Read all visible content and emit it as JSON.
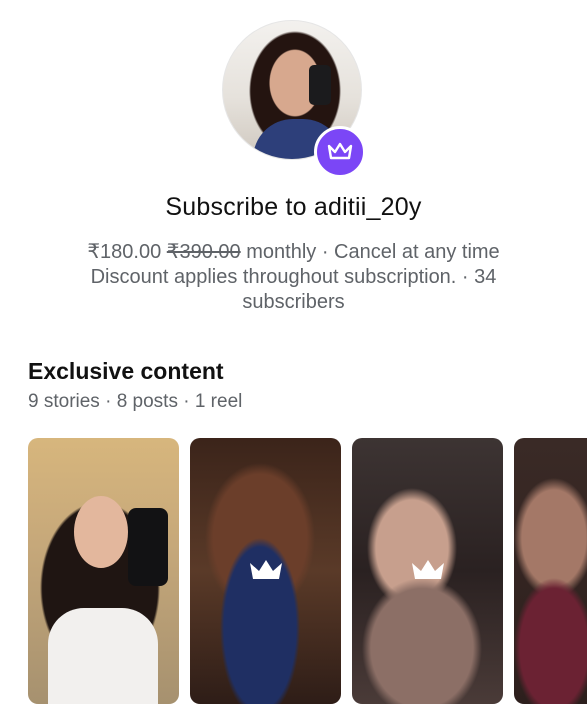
{
  "profile": {
    "title": "Subscribe to aditii_20y",
    "price_current": "₹180.00",
    "price_original": "₹390.00",
    "price_suffix": " monthly · Cancel at any time",
    "discount_note": "Discount applies throughout subscription. · 34 subscribers"
  },
  "exclusive": {
    "heading": "Exclusive content",
    "summary": "9 stories · 8 posts · 1 reel"
  },
  "icons": {
    "badge": "crown-icon",
    "locked": "crown-icon"
  },
  "colors": {
    "accent": "#7b46f6",
    "text_primary": "#111111",
    "text_secondary": "#5f6368"
  }
}
